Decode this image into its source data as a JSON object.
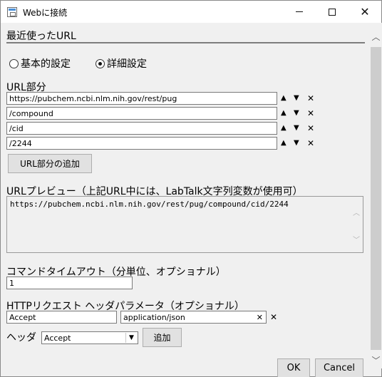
{
  "window": {
    "title": "Webに接続",
    "close_glyph": "✕"
  },
  "recent_urls_label": "最近使ったURL",
  "mode": {
    "basic_label": "基本的設定",
    "detailed_label": "詳細設定",
    "selected": "detailed"
  },
  "url_parts": {
    "label": "URL部分",
    "parts": [
      "https://pubchem.ncbi.nlm.nih.gov/rest/pug",
      "/compound",
      "/cid",
      "/2244"
    ],
    "add_button": "URL部分の追加",
    "move_up_glyph": "▲",
    "move_down_glyph": "▼",
    "delete_glyph": "✕"
  },
  "preview": {
    "label": "URLプレビュー（上記URL中には、LabTalk文字列変数が使用可）",
    "value": "https://pubchem.ncbi.nlm.nih.gov/rest/pug/compound/cid/2244"
  },
  "timeout": {
    "label": "コマンドタイムアウト（分単位、オプショナル）",
    "value": "1"
  },
  "headers": {
    "label": "HTTPリクエスト ヘッダパラメータ（オプショナル）",
    "name_value": "Accept",
    "value_value": "application/json",
    "clear_glyph": "✕",
    "delete_glyph": "✕",
    "select_label": "ヘッダ",
    "select_value": "Accept",
    "add_button": "追加"
  },
  "footer": {
    "ok": "OK",
    "cancel": "Cancel"
  }
}
